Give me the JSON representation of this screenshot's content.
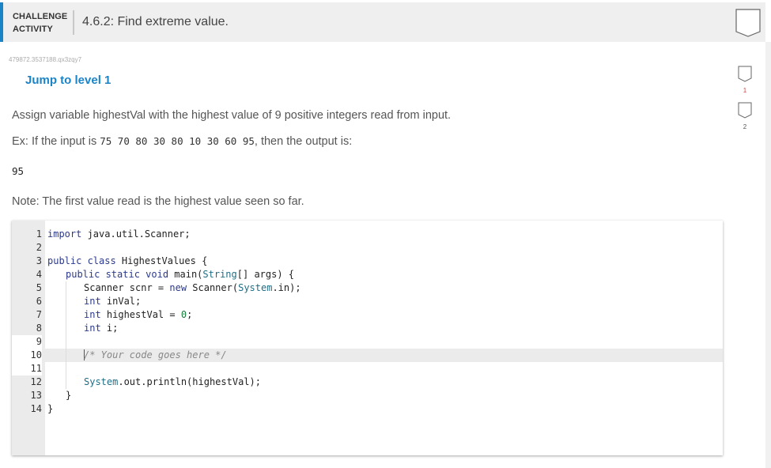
{
  "header": {
    "kind_line1": "CHALLENGE",
    "kind_line2": "ACTIVITY",
    "title": "4.6.2: Find extreme value.",
    "accent_color": "#1a84c7"
  },
  "activity_id": "479872.3537188.qx3zqy7",
  "jump_link": "Jump to level 1",
  "levels": [
    {
      "label": "1"
    },
    {
      "label": "2"
    }
  ],
  "instructions": {
    "line1": "Assign variable highestVal with the highest value of 9 positive integers read from input.",
    "ex_prefix": "Ex: If the input is ",
    "ex_input": "75 70 80 30 80 10 30 60 95",
    "ex_suffix": ", then the output is:",
    "output": "95",
    "note": "Note: The first value read is the highest value seen so far."
  },
  "editor": {
    "line_numbers": [
      "1",
      "2",
      "3",
      "4",
      "5",
      "6",
      "7",
      "8",
      "9",
      "10",
      "11",
      "12",
      "13",
      "14"
    ],
    "lines": {
      "l1_kw": "import",
      "l1_rest": " java.util.Scanner;",
      "l3_kw": "public class",
      "l3_rest": " HighestValues {",
      "l4_kw": "public static void",
      "l4_rest1": " main(",
      "l4_ty": "String",
      "l4_rest2": "[] args) {",
      "l5_a": "Scanner scnr = ",
      "l5_kw": "new",
      "l5_b": " Scanner(",
      "l5_ty": "System",
      "l5_c": ".in);",
      "l6_kw": "int",
      "l6_rest": " inVal;",
      "l7_kw": "int",
      "l7_rest": " highestVal = ",
      "l7_num": "0",
      "l7_end": ";",
      "l8_kw": "int",
      "l8_rest": " i;",
      "l10_comment": "/* Your code goes here */",
      "l12_ty": "System",
      "l12_rest": ".out.println(highestVal);",
      "l13": "}",
      "l14": "}"
    }
  }
}
